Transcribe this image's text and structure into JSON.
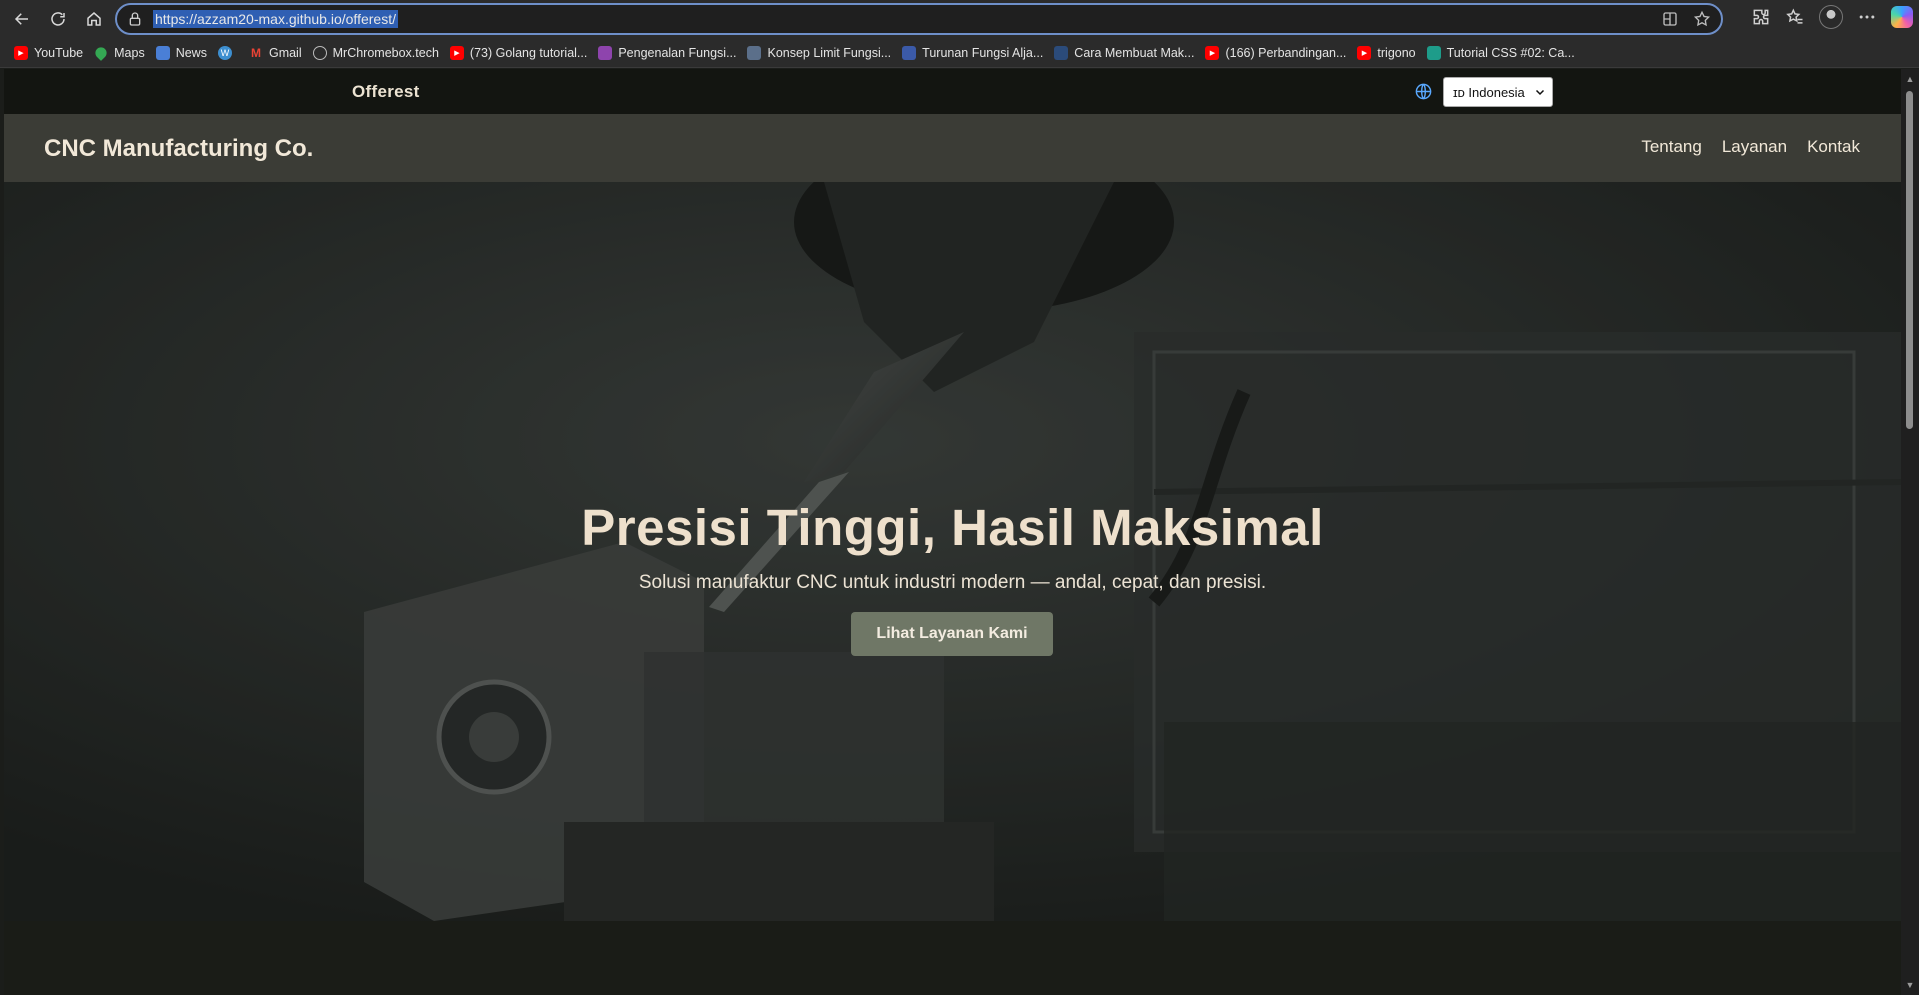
{
  "browser": {
    "url": "https://azzam20-max.github.io/offerest/",
    "bookmarks": [
      {
        "label": "YouTube",
        "icon": "youtube-icon",
        "color": "#ff0000"
      },
      {
        "label": "Maps",
        "icon": "maps-pin-icon",
        "color": "#34a853"
      },
      {
        "label": "News",
        "icon": "news-icon",
        "color": "#4a7fd6"
      },
      {
        "label": "",
        "icon": "wordpress-icon",
        "color": "#3d8fd0"
      },
      {
        "label": "Gmail",
        "icon": "gmail-icon",
        "color": "#ea4335"
      },
      {
        "label": "MrChromebox.tech",
        "icon": "globe-icon",
        "color": "#bbbbbb"
      },
      {
        "label": "(73) Golang tutorial...",
        "icon": "youtube-icon",
        "color": "#ff0000"
      },
      {
        "label": "Pengenalan Fungsi...",
        "icon": "site-icon",
        "color": "#8e44ad"
      },
      {
        "label": "Konsep Limit Fungsi...",
        "icon": "site-icon",
        "color": "#5b6f8a"
      },
      {
        "label": "Turunan Fungsi Alja...",
        "icon": "site-icon",
        "color": "#3b5aa8"
      },
      {
        "label": "Cara Membuat Mak...",
        "icon": "site-icon",
        "color": "#2b4b7a"
      },
      {
        "label": "(166) Perbandingan...",
        "icon": "youtube-icon",
        "color": "#ff0000"
      },
      {
        "label": "trigono",
        "icon": "youtube-icon",
        "color": "#ff0000"
      },
      {
        "label": "Tutorial CSS #02: Ca...",
        "icon": "site-icon",
        "color": "#1e9c8a"
      }
    ]
  },
  "topbar": {
    "brand": "Offerest",
    "language": "ɪᴅ Indonesia"
  },
  "navbar": {
    "title": "CNC Manufacturing Co.",
    "links": [
      "Tentang",
      "Layanan",
      "Kontak"
    ]
  },
  "hero": {
    "title": "Presisi Tinggi, Hasil Maksimal",
    "subtitle": "Solusi manufaktur CNC untuk industri modern — andal, cepat, dan presisi.",
    "cta": "Lihat Layanan Kami"
  },
  "colors": {
    "accent_button": "#6f7766",
    "navbar": "#3b3c36",
    "topbar": "#131511",
    "heading_text": "#eee0cc"
  }
}
